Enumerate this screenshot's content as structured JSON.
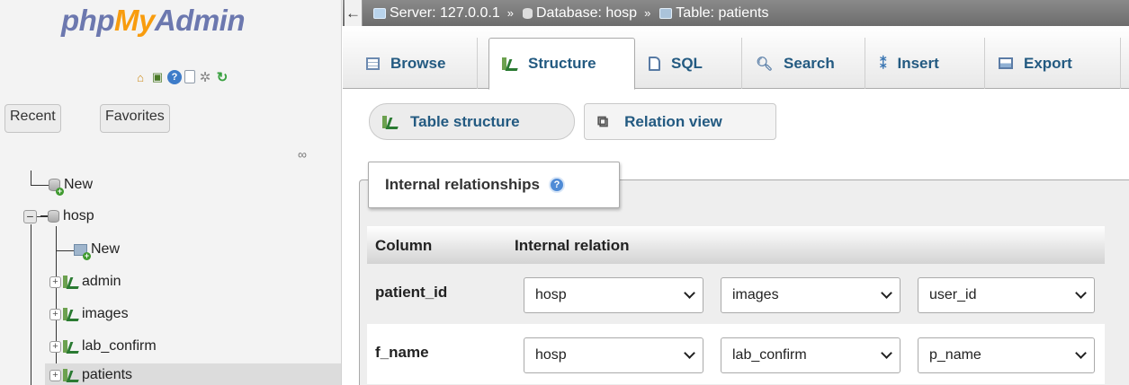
{
  "sidebar": {
    "logo": {
      "part1": "php",
      "part2": "My",
      "part3": "Admin"
    },
    "nav_icons": [
      "home-icon",
      "exit-icon",
      "help-icon",
      "docs-icon",
      "settings-icon",
      "reload-icon"
    ],
    "tabs": {
      "recent": "Recent",
      "favorites": "Favorites"
    },
    "tree": {
      "new_root": "New",
      "database": "hosp",
      "new_table": "New",
      "tables": [
        "admin",
        "images",
        "lab_confirm",
        "patients"
      ]
    }
  },
  "breadcrumb": {
    "back_arrow": "←",
    "server": "Server: 127.0.0.1",
    "database": "Database: hosp",
    "table": "Table: patients",
    "separator": "»"
  },
  "topmenu": {
    "tabs": [
      "Browse",
      "Structure",
      "SQL",
      "Search",
      "Insert",
      "Export"
    ],
    "active": "Structure"
  },
  "subtabs": {
    "table_structure": "Table structure",
    "relation_view": "Relation view"
  },
  "relations": {
    "legend": "Internal relationships",
    "headers": {
      "column": "Column",
      "relation": "Internal relation"
    },
    "rows": [
      {
        "column": "patient_id",
        "database": "hosp",
        "table": "images",
        "field": "user_id"
      },
      {
        "column": "f_name",
        "database": "hosp",
        "table": "lab_confirm",
        "field": "p_name"
      }
    ]
  },
  "colors": {
    "accent": "#235a81",
    "logo_blue": "#6c78af",
    "logo_orange": "#f89c0e"
  }
}
